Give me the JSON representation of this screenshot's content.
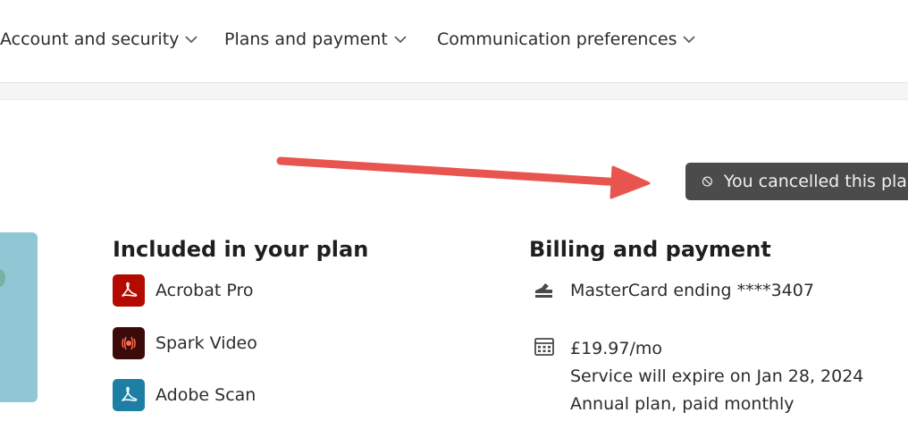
{
  "nav": {
    "items": [
      {
        "label": "Account and security"
      },
      {
        "label": "Plans and payment"
      },
      {
        "label": "Communication preferences"
      }
    ]
  },
  "status_badge": {
    "label": "You cancelled this plan"
  },
  "included": {
    "title": "Included in your plan",
    "apps": [
      {
        "label": "Acrobat Pro",
        "icon": "acrobat-icon",
        "color": "#b30b00"
      },
      {
        "label": "Spark Video",
        "icon": "spark-video-icon",
        "color": "#3d0a0a"
      },
      {
        "label": "Adobe Scan",
        "icon": "adobe-scan-icon",
        "color": "#1c7fa3"
      }
    ]
  },
  "billing": {
    "title": "Billing and payment",
    "card": "MasterCard ending ****3407",
    "price": "£19.97/mo",
    "expiry": "Service will expire on Jan 28, 2024",
    "plan_type": "Annual plan, paid monthly"
  },
  "colors": {
    "arrow": "#e8544e",
    "badge_bg": "#4b4b4b"
  }
}
